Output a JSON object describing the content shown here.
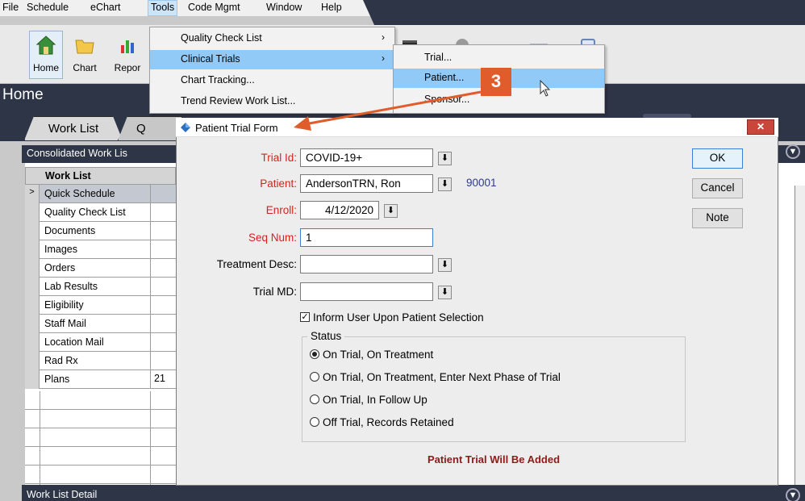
{
  "menubar": {
    "items": [
      "File",
      "Schedule",
      "eChart",
      "Tools",
      "Code Mgmt",
      "Window",
      "Help"
    ]
  },
  "toolbar": {
    "buttons": [
      "Home",
      "Chart",
      "Repor"
    ]
  },
  "home": {
    "title": "Home"
  },
  "tabs": [
    "Work List",
    "Q"
  ],
  "worklist": {
    "panel_title": "Consolidated Work Lis",
    "column_header": "Work List",
    "rows": [
      {
        "label": "Quick Schedule",
        "value": "",
        "selected": true
      },
      {
        "label": "Quality Check List",
        "value": ""
      },
      {
        "label": "Documents",
        "value": ""
      },
      {
        "label": "Images",
        "value": ""
      },
      {
        "label": "Orders",
        "value": ""
      },
      {
        "label": "Lab Results",
        "value": ""
      },
      {
        "label": "Eligibility",
        "value": ""
      },
      {
        "label": "Staff Mail",
        "value": ""
      },
      {
        "label": "Location Mail",
        "value": ""
      },
      {
        "label": "Rad Rx",
        "value": ""
      },
      {
        "label": "Plans",
        "value": "21"
      }
    ],
    "detail_title": "Work List Detail"
  },
  "tools_menu": {
    "items": [
      {
        "label": "Quality Check List",
        "submenu": true
      },
      {
        "label": "Clinical Trials",
        "submenu": true,
        "highlighted": true
      },
      {
        "label": "Chart Tracking...",
        "submenu": false
      },
      {
        "label": "Trend Review Work List...",
        "submenu": false
      }
    ]
  },
  "trials_submenu": {
    "items": [
      {
        "label": "Trial..."
      },
      {
        "label": "Patient...",
        "highlighted": true
      },
      {
        "label": "Sponsor..."
      }
    ]
  },
  "step_badge": "3",
  "dialog": {
    "title": "Patient Trial Form",
    "fields": {
      "trial_id": {
        "label": "Trial Id:",
        "value": "COVID-19+"
      },
      "patient": {
        "label": "Patient:",
        "value": "AndersonTRN, Ron",
        "id": "90001"
      },
      "enroll": {
        "label": "Enroll:",
        "value": "4/12/2020"
      },
      "seq_num": {
        "label": "Seq Num:",
        "value": "1"
      },
      "treatment_desc": {
        "label": "Treatment Desc:",
        "value": ""
      },
      "trial_md": {
        "label": "Trial MD:",
        "value": ""
      }
    },
    "inform_checkbox": {
      "label": "Inform User Upon Patient Selection",
      "checked": true
    },
    "status": {
      "label": "Status",
      "options": [
        {
          "label": "On Trial, On Treatment",
          "selected": true
        },
        {
          "label": "On Trial, On Treatment, Enter Next Phase of Trial",
          "selected": false
        },
        {
          "label": "On Trial, In Follow Up",
          "selected": false
        },
        {
          "label": "Off Trial, Records Retained",
          "selected": false
        }
      ]
    },
    "buttons": {
      "ok": "OK",
      "cancel": "Cancel",
      "note": "Note"
    },
    "message": "Patient Trial Will Be Added"
  },
  "colors": {
    "navy": "#2e3547",
    "accent_orange": "#e05c2a",
    "required_red": "#d1241f",
    "menu_highlight": "#91c9f7"
  }
}
